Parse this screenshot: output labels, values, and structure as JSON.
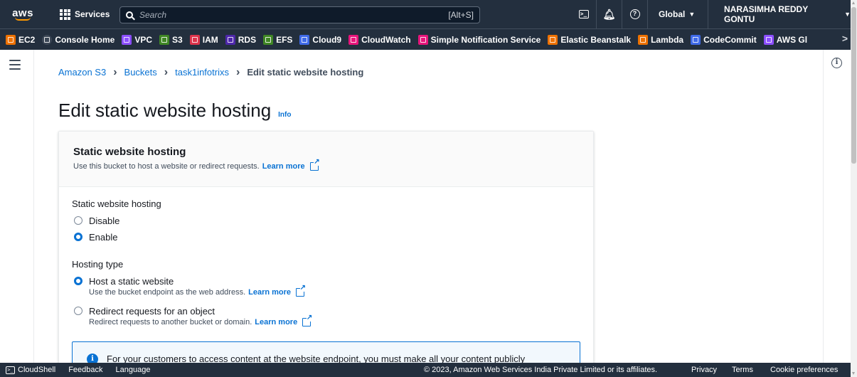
{
  "topnav": {
    "logo_text": "aws",
    "services_label": "Services",
    "search_placeholder": "Search",
    "search_shortcut": "[Alt+S]",
    "region_label": "Global",
    "user_label": "NARASIMHA REDDY GONTU"
  },
  "favorites": [
    {
      "label": "EC2",
      "color": "#ed7100"
    },
    {
      "label": "Console Home",
      "color": "#3b4655"
    },
    {
      "label": "VPC",
      "color": "#8c4fff"
    },
    {
      "label": "S3",
      "color": "#3f8624"
    },
    {
      "label": "IAM",
      "color": "#dd344c"
    },
    {
      "label": "RDS",
      "color": "#4d27aa"
    },
    {
      "label": "EFS",
      "color": "#3f8624"
    },
    {
      "label": "Cloud9",
      "color": "#3f6ae8"
    },
    {
      "label": "CloudWatch",
      "color": "#e7157b"
    },
    {
      "label": "Simple Notification Service",
      "color": "#e7157b"
    },
    {
      "label": "Elastic Beanstalk",
      "color": "#ed7100"
    },
    {
      "label": "Lambda",
      "color": "#ed7100"
    },
    {
      "label": "CodeCommit",
      "color": "#3f6ae8"
    },
    {
      "label": "AWS Gl",
      "color": "#8c4fff"
    }
  ],
  "breadcrumb": {
    "items": [
      "Amazon S3",
      "Buckets",
      "task1infotrixs"
    ],
    "current": "Edit static website hosting"
  },
  "page": {
    "title": "Edit static website hosting",
    "info_link": "Info"
  },
  "panel": {
    "title": "Static website hosting",
    "description": "Use this bucket to host a website or redirect requests.",
    "learn_more": "Learn more",
    "hosting_field_label": "Static website hosting",
    "hosting_options": [
      {
        "label": "Disable",
        "selected": false
      },
      {
        "label": "Enable",
        "selected": true
      }
    ],
    "type_field_label": "Hosting type",
    "type_options": [
      {
        "label": "Host a static website",
        "description": "Use the bucket endpoint as the web address.",
        "selected": true
      },
      {
        "label": "Redirect requests for an object",
        "description": "Redirect requests to another bucket or domain.",
        "selected": false
      }
    ],
    "alert_text": "For your customers to access content at the website endpoint, you must make all your content publicly"
  },
  "footer": {
    "cloudshell": "CloudShell",
    "feedback": "Feedback",
    "language": "Language",
    "copyright": "© 2023, Amazon Web Services India Private Limited or its affiliates.",
    "privacy": "Privacy",
    "terms": "Terms",
    "cookies": "Cookie preferences"
  }
}
